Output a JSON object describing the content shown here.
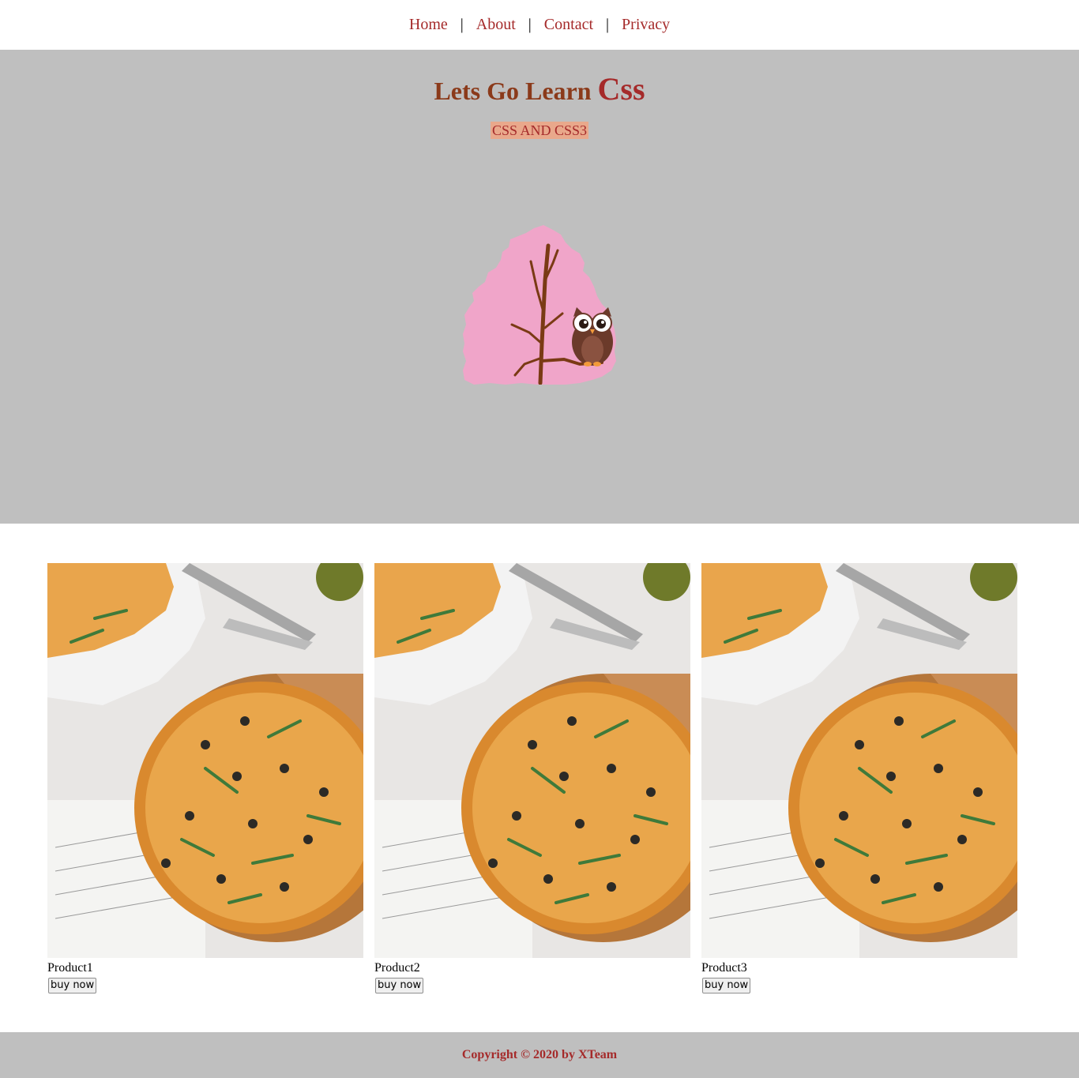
{
  "nav": {
    "items": [
      {
        "label": "Home"
      },
      {
        "label": "About"
      },
      {
        "label": "Contact"
      },
      {
        "label": "Privacy"
      }
    ],
    "separator": "|"
  },
  "hero": {
    "title_prefix": "Lets Go Learn ",
    "title_emphasis": "Css",
    "subtitle": "CSS AND CSS3",
    "background_color": "#bfbfbf",
    "illustration": "owl-on-pink-tree"
  },
  "products": [
    {
      "name": "Product1",
      "button_label": "buy now",
      "image": "pizza-photo"
    },
    {
      "name": "Product2",
      "button_label": "buy now",
      "image": "pizza-photo"
    },
    {
      "name": "Product3",
      "button_label": "buy now",
      "image": "pizza-photo"
    }
  ],
  "footer": {
    "text": "Copyright © 2020 by XTeam"
  },
  "colors": {
    "accent": "#a52a2a",
    "title": "#8b3a1a",
    "subtitle_bg": "#e9a88b",
    "tree_pink": "#f0a5c9",
    "branch_brown": "#7a3a14"
  }
}
